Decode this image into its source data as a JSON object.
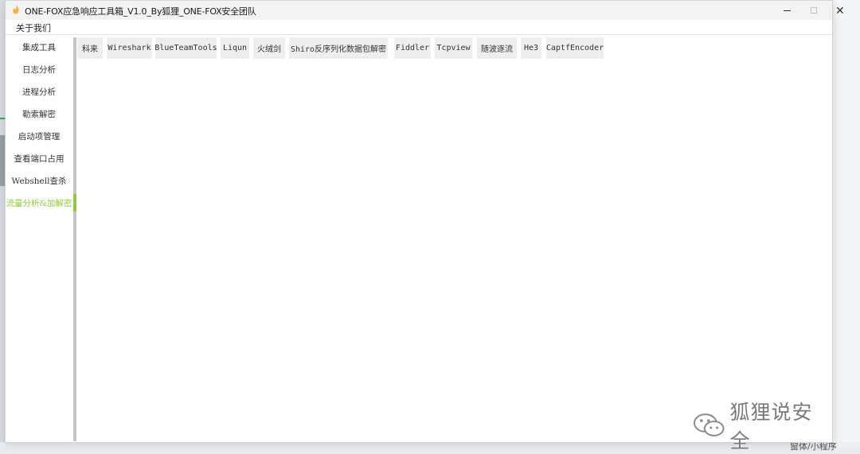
{
  "window": {
    "title": "ONE-FOX应急响应工具箱_V1.0_By狐狸_ONE-FOX安全团队",
    "close_glyph": "✕"
  },
  "menu": {
    "items": [
      {
        "label": "关于我们"
      }
    ]
  },
  "sidebar": {
    "items": [
      {
        "label": "集成工具"
      },
      {
        "label": "日志分析"
      },
      {
        "label": "进程分析"
      },
      {
        "label": "勒索解密"
      },
      {
        "label": "启动项管理"
      },
      {
        "label": "查看端口占用"
      },
      {
        "label": "Webshell查杀"
      },
      {
        "label": "流量分析&加解密"
      }
    ],
    "active_index": 7
  },
  "tabs": {
    "items": [
      {
        "label": "科来"
      },
      {
        "label": "Wireshark"
      },
      {
        "label": "BlueTeamTools"
      },
      {
        "label": "Liqun"
      },
      {
        "label": "火绒剑"
      },
      {
        "label": "Shiro反序列化数据包解密"
      },
      {
        "label": "Fiddler"
      },
      {
        "label": "Tcpview"
      },
      {
        "label": "随波逐流"
      },
      {
        "label": "He3"
      },
      {
        "label": "CaptfEncoder"
      }
    ]
  },
  "watermark": {
    "text": "狐狸说安全"
  },
  "background": {
    "bottom_text": "窗体/小程序"
  },
  "colors": {
    "accent": "#8fca39",
    "tab_bg": "#eeeeee",
    "titlebar_bg": "#f3f3f3"
  },
  "icons": {
    "app": "fox-flame-icon",
    "minimize": "minimize-icon",
    "maximize": "maximize-icon",
    "close": "close-icon",
    "watermark": "wechat-icon"
  }
}
